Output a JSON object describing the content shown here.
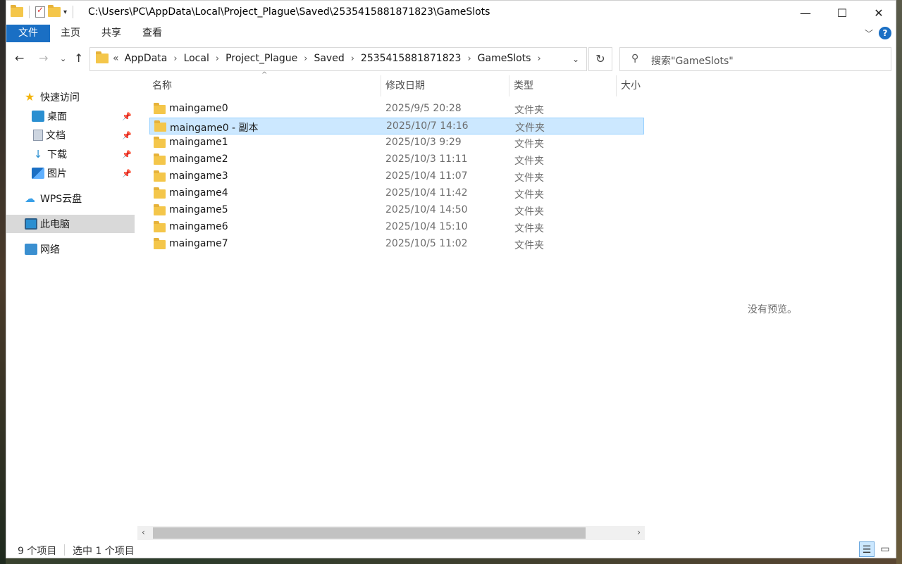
{
  "window": {
    "title": "C:\\Users\\PC\\AppData\\Local\\Project_Plague\\Saved\\2535415881871823\\GameSlots",
    "controls": {
      "minimize": "—",
      "maximize": "☐",
      "close": "✕"
    }
  },
  "ribbon": {
    "tabs": [
      "文件",
      "主页",
      "共享",
      "查看"
    ],
    "help": "?"
  },
  "address": {
    "overflow": "«",
    "crumbs": [
      "AppData",
      "Local",
      "Project_Plague",
      "Saved",
      "2535415881871823",
      "GameSlots"
    ]
  },
  "search": {
    "placeholder": "搜索\"GameSlots\""
  },
  "sidebar": {
    "items": [
      {
        "label": "快速访问",
        "icon": "star-icon"
      },
      {
        "label": "桌面",
        "icon": "desktop-icon",
        "pinned": true
      },
      {
        "label": "文档",
        "icon": "document-icon",
        "pinned": true
      },
      {
        "label": "下载",
        "icon": "download-icon",
        "pinned": true
      },
      {
        "label": "图片",
        "icon": "pictures-icon",
        "pinned": true
      },
      {
        "label": "WPS云盘",
        "icon": "cloud-icon"
      },
      {
        "label": "此电脑",
        "icon": "computer-icon",
        "selected": true
      },
      {
        "label": "网络",
        "icon": "network-icon"
      }
    ]
  },
  "columns": {
    "name": "名称",
    "modified": "修改日期",
    "type": "类型",
    "size": "大小"
  },
  "files": [
    {
      "name": "maingame0",
      "modified": "2025/9/5 20:28",
      "type": "文件夹"
    },
    {
      "name": "maingame0 - 副本",
      "modified": "2025/10/7 14:16",
      "type": "文件夹",
      "selected": true
    },
    {
      "name": "maingame1",
      "modified": "2025/10/3 9:29",
      "type": "文件夹"
    },
    {
      "name": "maingame2",
      "modified": "2025/10/3 11:11",
      "type": "文件夹"
    },
    {
      "name": "maingame3",
      "modified": "2025/10/4 11:07",
      "type": "文件夹"
    },
    {
      "name": "maingame4",
      "modified": "2025/10/4 11:42",
      "type": "文件夹"
    },
    {
      "name": "maingame5",
      "modified": "2025/10/4 14:50",
      "type": "文件夹"
    },
    {
      "name": "maingame6",
      "modified": "2025/10/4 15:10",
      "type": "文件夹"
    },
    {
      "name": "maingame7",
      "modified": "2025/10/5 11:02",
      "type": "文件夹"
    }
  ],
  "preview": {
    "message": "没有预览。"
  },
  "status": {
    "count": "9 个项目",
    "selection": "选中 1 个项目"
  },
  "colors": {
    "accent": "#1a6fc4",
    "selection": "#cce8ff",
    "folder": "#f4c64a"
  }
}
